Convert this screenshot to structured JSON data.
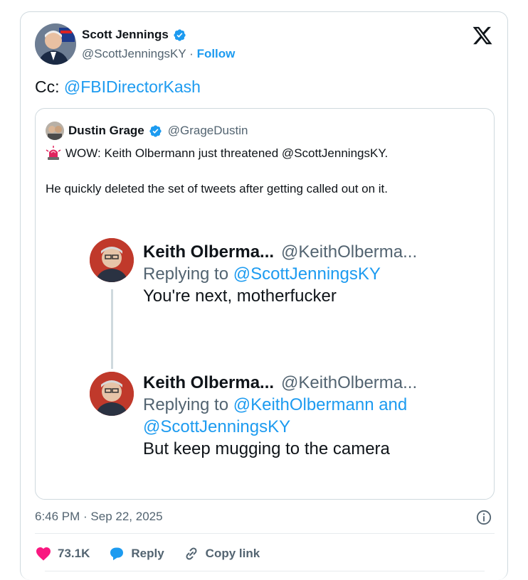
{
  "author": {
    "name": "Scott Jennings",
    "handle": "@ScottJenningsKY",
    "separator": "·",
    "follow_label": "Follow"
  },
  "tweet": {
    "prefix": "Cc: ",
    "mention": "@FBIDirectorKash"
  },
  "quote": {
    "name": "Dustin Grage",
    "handle": "@GrageDustin",
    "line1": "WOW: Keith Olbermann just threatened @ScottJenningsKY.",
    "line2": "He quickly deleted the set of tweets after getting called out on it.",
    "screenshot": {
      "post1": {
        "name": "Keith Olberma...",
        "handle": "@KeithOlberma...",
        "replying_prefix": "Replying to ",
        "replying_to": "@ScottJenningsKY",
        "text": "You're next, motherfucker"
      },
      "post2": {
        "name": "Keith Olberma...",
        "handle": "@KeithOlberma...",
        "replying_prefix": "Replying to ",
        "replying_to_line1": "@KeithOlbermann and",
        "replying_to_line2": "@ScottJenningsKY",
        "text": "But keep mugging to the camera"
      }
    }
  },
  "timestamp": "6:46 PM · Sep 22, 2025",
  "actions": {
    "likes": "73.1K",
    "reply_label": "Reply",
    "copy_link_label": "Copy link"
  },
  "colors": {
    "accent": "#1d9bf0",
    "like": "#f91880",
    "muted": "#536471",
    "border": "#cfd9de"
  }
}
